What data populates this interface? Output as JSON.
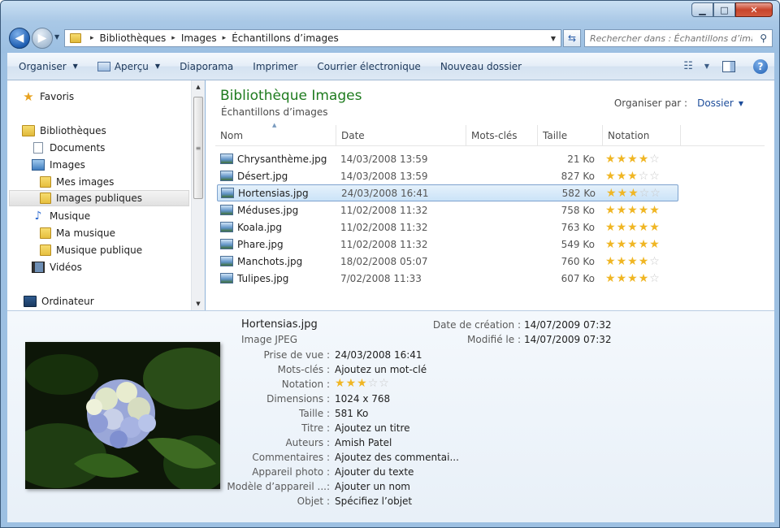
{
  "window": {
    "caption": {
      "minimize": "▁",
      "maximize": "□",
      "close": "✕"
    }
  },
  "address": {
    "crumbs": [
      "Bibliothèques",
      "Images",
      "Échantillons d’images"
    ],
    "separator": "▸",
    "dropdown": "▾"
  },
  "search": {
    "placeholder": "Rechercher dans : Échantillons d’ima..."
  },
  "toolbar": {
    "organize": "Organiser",
    "preview": "Aperçu",
    "slideshow": "Diaporama",
    "print": "Imprimer",
    "email": "Courrier électronique",
    "new_folder": "Nouveau dossier"
  },
  "navpane": {
    "favorites": "Favoris",
    "libraries": "Bibliothèques",
    "documents": "Documents",
    "images": "Images",
    "my_images": "Mes images",
    "public_images": "Images publiques",
    "music": "Musique",
    "my_music": "Ma musique",
    "public_music": "Musique publique",
    "videos": "Vidéos",
    "computer": "Ordinateur"
  },
  "main": {
    "title": "Bibliothèque Images",
    "subtitle": "Échantillons d’images",
    "arrange_label": "Organiser par :",
    "arrange_value": "Dossier",
    "columns": [
      "Nom",
      "Date",
      "Mots-clés",
      "Taille",
      "Notation"
    ],
    "files": [
      {
        "name": "Chrysanthème.jpg",
        "date": "14/03/2008 13:59",
        "size": "21 Ko",
        "rating": 4
      },
      {
        "name": "Désert.jpg",
        "date": "14/03/2008 13:59",
        "size": "827 Ko",
        "rating": 3
      },
      {
        "name": "Hortensias.jpg",
        "date": "24/03/2008 16:41",
        "size": "582 Ko",
        "rating": 3
      },
      {
        "name": "Méduses.jpg",
        "date": "11/02/2008 11:32",
        "size": "758 Ko",
        "rating": 5
      },
      {
        "name": "Koala.jpg",
        "date": "11/02/2008 11:32",
        "size": "763 Ko",
        "rating": 5
      },
      {
        "name": "Phare.jpg",
        "date": "11/02/2008 11:32",
        "size": "549 Ko",
        "rating": 5
      },
      {
        "name": "Manchots.jpg",
        "date": "18/02/2008 05:07",
        "size": "760 Ko",
        "rating": 4
      },
      {
        "name": "Tulipes.jpg",
        "date": "7/02/2008 11:33",
        "size": "607 Ko",
        "rating": 4
      }
    ],
    "selected_index": 2
  },
  "details": {
    "title": "Hortensias.jpg",
    "type": "Image JPEG",
    "created_label": "Date de création :",
    "created_value": "14/07/2009 07:32",
    "modified_label": "Modifié le :",
    "modified_value": "14/07/2009 07:32",
    "properties": [
      {
        "label": "Prise de vue :",
        "value": "24/03/2008 16:41"
      },
      {
        "label": "Mots-clés :",
        "value": "Ajoutez un mot-clé"
      },
      {
        "label": "Notation :",
        "value": ""
      },
      {
        "label": "Dimensions :",
        "value": "1024 x 768"
      },
      {
        "label": "Taille :",
        "value": "581 Ko"
      },
      {
        "label": "Titre :",
        "value": "Ajoutez un titre"
      },
      {
        "label": "Auteurs :",
        "value": "Amish Patel"
      },
      {
        "label": "Commentaires :",
        "value": "Ajoutez des commentai..."
      },
      {
        "label": "Appareil photo :",
        "value": "Ajouter du texte"
      },
      {
        "label": "Modèle d’appareil ...:",
        "value": "Ajouter un nom"
      },
      {
        "label": "Objet :",
        "value": "Spécifiez l’objet"
      }
    ],
    "rating": 3
  },
  "colors": {
    "accent_title": "#1e7b1e",
    "link": "#1c4c9a",
    "star": "#f0b624"
  }
}
